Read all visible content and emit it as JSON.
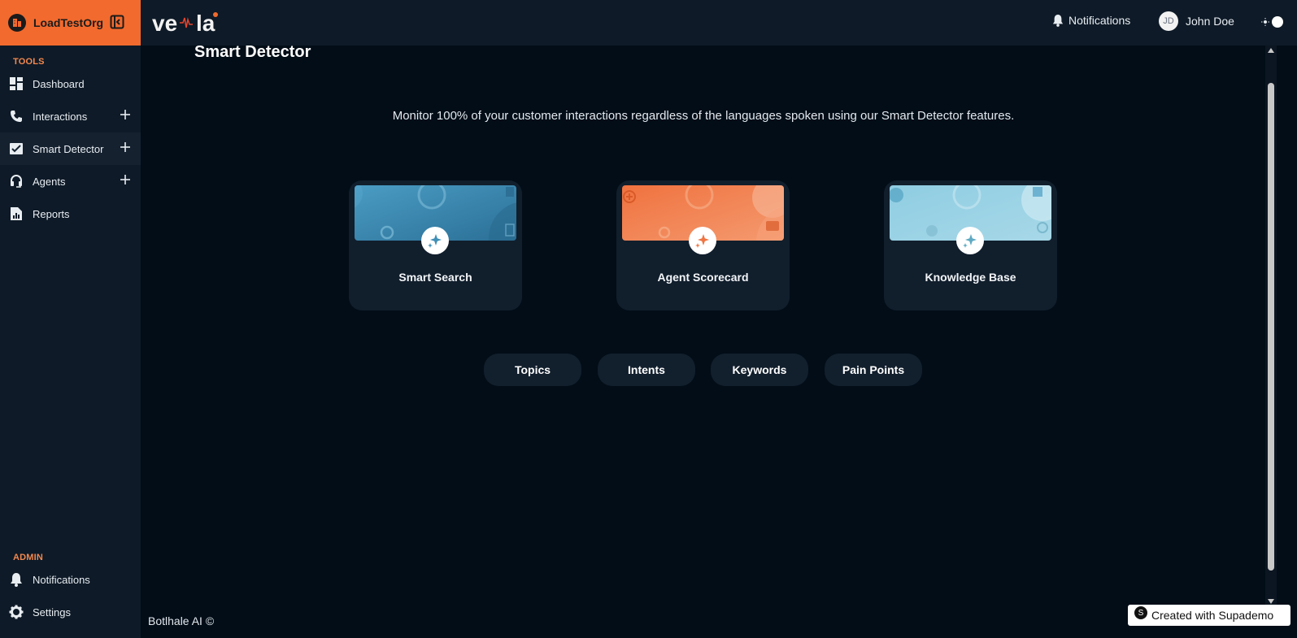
{
  "org": {
    "name": "LoadTestOrg"
  },
  "sidebar": {
    "tools_label": "TOOLS",
    "admin_label": "ADMIN",
    "items": [
      {
        "label": "Dashboard",
        "icon": "dashboard-icon"
      },
      {
        "label": "Interactions",
        "icon": "phone-icon",
        "expandable": true
      },
      {
        "label": "Smart Detector",
        "icon": "check-chart-icon",
        "expandable": true,
        "active": true
      },
      {
        "label": "Agents",
        "icon": "headset-icon",
        "expandable": true
      },
      {
        "label": "Reports",
        "icon": "report-icon"
      }
    ],
    "admin_items": [
      {
        "label": "Notifications",
        "icon": "bell-icon"
      },
      {
        "label": "Settings",
        "icon": "gear-icon"
      }
    ]
  },
  "header": {
    "logo_text": "vela",
    "notifications_label": "Notifications",
    "user": {
      "initials": "JD",
      "name": "John Doe"
    }
  },
  "main": {
    "title": "Smart Detector",
    "subtitle": "Monitor 100% of your customer interactions regardless of the languages spoken using our Smart Detector features.",
    "cards": [
      {
        "label": "Smart Search",
        "color": "#3f8fb6"
      },
      {
        "label": "Agent Scorecard",
        "color": "#ef7543"
      },
      {
        "label": "Knowledge Base",
        "color": "#8ccbe0"
      }
    ],
    "pills": [
      "Topics",
      "Intents",
      "Keywords",
      "Pain Points"
    ]
  },
  "footer": {
    "text": "Botlhale AI ©"
  },
  "supademo": {
    "label": "Created with Supademo"
  },
  "colors": {
    "accent": "#f26a2e",
    "sidebar_bg": "#0e1a27",
    "page_bg": "#020d17"
  }
}
